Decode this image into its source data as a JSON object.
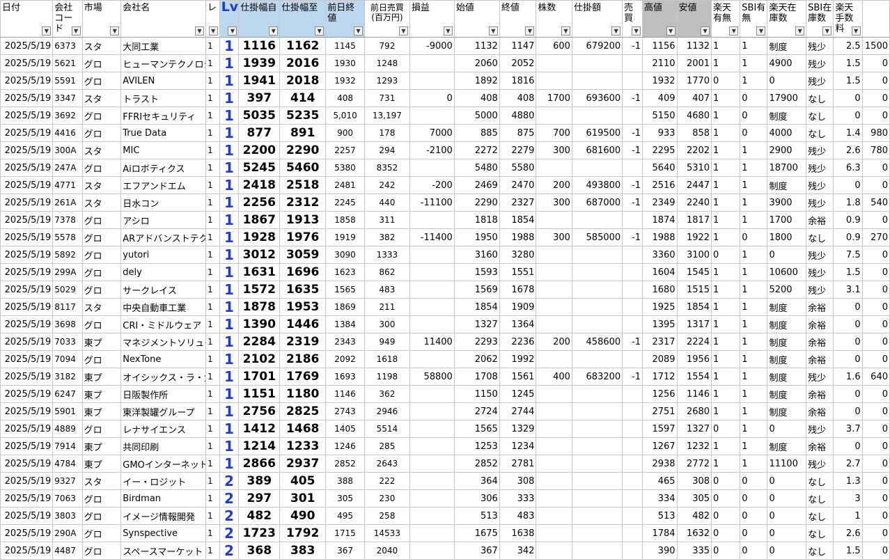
{
  "columns": [
    {
      "key": "date",
      "label": "日付",
      "w": 73
    },
    {
      "key": "code",
      "label": "会社コード",
      "w": 41
    },
    {
      "key": "market",
      "label": "市場",
      "w": 54
    },
    {
      "key": "name",
      "label": "会社名",
      "w": 118
    },
    {
      "key": "rei",
      "label": "レ",
      "w": 19
    },
    {
      "key": "lv",
      "label": "Lv",
      "w": 27
    },
    {
      "key": "from",
      "label": "仕掛幅自",
      "w": 57
    },
    {
      "key": "to",
      "label": "仕掛幅至",
      "w": 64
    },
    {
      "key": "prevclose",
      "label": "前日終値",
      "w": 54
    },
    {
      "key": "prevsell",
      "label": "前日売買(百万円)",
      "w": 63
    },
    {
      "key": "pl",
      "label": "損益",
      "w": 62
    },
    {
      "key": "open",
      "label": "始値",
      "w": 63
    },
    {
      "key": "close",
      "label": "終値",
      "w": 51
    },
    {
      "key": "shares",
      "label": "株数",
      "w": 50
    },
    {
      "key": "amount",
      "label": "仕掛額",
      "w": 70
    },
    {
      "key": "sell",
      "label": "売買",
      "w": 28
    },
    {
      "key": "high",
      "label": "高値",
      "w": 48
    },
    {
      "key": "low",
      "label": "安値",
      "w": 48
    },
    {
      "key": "rak",
      "label": "楽天有無",
      "w": 40
    },
    {
      "key": "sbi",
      "label": "SBI有無",
      "w": 38
    },
    {
      "key": "rakstock",
      "label": "楽天在庫数",
      "w": 54
    },
    {
      "key": "sbistock",
      "label": "SBI在庫数",
      "w": 38
    },
    {
      "key": "fee",
      "label": "楽天手数料",
      "w": 40
    },
    {
      "key": "fee2",
      "label": "",
      "w": 38
    }
  ],
  "rows": [
    [
      "2025/5/19",
      "6373",
      "スタ",
      "大同工業",
      "1",
      "1",
      "1116",
      "1162",
      "1145",
      "792",
      "-9000",
      "1132",
      "1147",
      "600",
      "679200",
      "-1",
      "1156",
      "1132",
      "1",
      "1",
      "制度",
      "残少",
      "2.5",
      "1500"
    ],
    [
      "2025/5/19",
      "5621",
      "グロ",
      "ヒューマンテクノロジーズ",
      "1",
      "1",
      "1939",
      "2016",
      "1930",
      "1248",
      "",
      "2060",
      "2052",
      "",
      "",
      "",
      "2110",
      "2001",
      "1",
      "1",
      "4900",
      "残少",
      "1.5",
      "0"
    ],
    [
      "2025/5/19",
      "5591",
      "グロ",
      "AVILEN",
      "1",
      "1",
      "1941",
      "2018",
      "1932",
      "1293",
      "",
      "1892",
      "1816",
      "",
      "",
      "",
      "1932",
      "1770",
      "0",
      "1",
      "0",
      "残少",
      "1.5",
      "0"
    ],
    [
      "2025/5/19",
      "3347",
      "スタ",
      "トラスト",
      "1",
      "1",
      "397",
      "414",
      "408",
      "731",
      "0",
      "408",
      "408",
      "1700",
      "693600",
      "-1",
      "409",
      "407",
      "1",
      "0",
      "17900",
      "なし",
      "0",
      "0"
    ],
    [
      "2025/5/19",
      "3692",
      "グロ",
      "FFRIセキュリティ",
      "1",
      "1",
      "5035",
      "5235",
      "5,010",
      "13,197",
      "",
      "5000",
      "4880",
      "",
      "",
      "",
      "5150",
      "4680",
      "1",
      "0",
      "制度",
      "なし",
      "0",
      "0"
    ],
    [
      "2025/5/19",
      "4416",
      "グロ",
      "True Data",
      "1",
      "1",
      "877",
      "891",
      "900",
      "178",
      "7000",
      "885",
      "875",
      "700",
      "619500",
      "-1",
      "933",
      "858",
      "1",
      "0",
      "4000",
      "なし",
      "1.4",
      "980"
    ],
    [
      "2025/5/19",
      "300A",
      "スタ",
      "MIC",
      "1",
      "1",
      "2200",
      "2290",
      "2257",
      "294",
      "-2100",
      "2272",
      "2279",
      "300",
      "681600",
      "-1",
      "2295",
      "2202",
      "1",
      "1",
      "2900",
      "残少",
      "2.6",
      "780"
    ],
    [
      "2025/5/19",
      "247A",
      "グロ",
      "Aiロボティクス",
      "1",
      "1",
      "5245",
      "5460",
      "5380",
      "8352",
      "",
      "5480",
      "5580",
      "",
      "",
      "",
      "5640",
      "5310",
      "1",
      "1",
      "18700",
      "残少",
      "6.3",
      "0"
    ],
    [
      "2025/5/19",
      "4771",
      "スタ",
      "エフアンドエム",
      "1",
      "1",
      "2418",
      "2518",
      "2481",
      "242",
      "-200",
      "2469",
      "2470",
      "200",
      "493800",
      "-1",
      "2516",
      "2447",
      "1",
      "1",
      "制度",
      "残少",
      "0",
      "0"
    ],
    [
      "2025/5/19",
      "261A",
      "スタ",
      "日水コン",
      "1",
      "1",
      "2256",
      "2312",
      "2245",
      "440",
      "-11100",
      "2290",
      "2327",
      "300",
      "687000",
      "-1",
      "2349",
      "2240",
      "1",
      "1",
      "3900",
      "残少",
      "1.8",
      "540"
    ],
    [
      "2025/5/19",
      "7378",
      "グロ",
      "アシロ",
      "1",
      "1",
      "1867",
      "1913",
      "1858",
      "311",
      "",
      "1818",
      "1854",
      "",
      "",
      "",
      "1874",
      "1817",
      "1",
      "1",
      "1700",
      "余裕",
      "0.9",
      "0"
    ],
    [
      "2025/5/19",
      "5578",
      "グロ",
      "ARアドバンストテクノロジ",
      "1",
      "1",
      "1928",
      "1976",
      "1919",
      "382",
      "-11400",
      "1950",
      "1988",
      "300",
      "585000",
      "-1",
      "1988",
      "1922",
      "1",
      "0",
      "1800",
      "なし",
      "0.9",
      "270"
    ],
    [
      "2025/5/19",
      "5892",
      "グロ",
      "yutori",
      "1",
      "1",
      "3012",
      "3059",
      "3090",
      "1333",
      "",
      "3160",
      "3280",
      "",
      "",
      "",
      "3360",
      "3100",
      "0",
      "1",
      "0",
      "残少",
      "7.5",
      "0"
    ],
    [
      "2025/5/19",
      "299A",
      "グロ",
      "dely",
      "1",
      "1",
      "1631",
      "1696",
      "1623",
      "862",
      "",
      "1593",
      "1551",
      "",
      "",
      "",
      "1604",
      "1545",
      "1",
      "1",
      "10600",
      "残少",
      "1.5",
      "0"
    ],
    [
      "2025/5/19",
      "5029",
      "グロ",
      "サークレイス",
      "1",
      "1",
      "1572",
      "1635",
      "1565",
      "483",
      "",
      "1569",
      "1678",
      "",
      "",
      "",
      "1680",
      "1515",
      "1",
      "1",
      "5200",
      "残少",
      "3.1",
      "0"
    ],
    [
      "2025/5/19",
      "8117",
      "スタ",
      "中央自動車工業",
      "1",
      "1",
      "1878",
      "1953",
      "1869",
      "211",
      "",
      "1854",
      "1909",
      "",
      "",
      "",
      "1925",
      "1854",
      "1",
      "1",
      "制度",
      "余裕",
      "0",
      "0"
    ],
    [
      "2025/5/19",
      "3698",
      "グロ",
      "CRI・ミドルウェア",
      "1",
      "1",
      "1390",
      "1446",
      "1384",
      "300",
      "",
      "1327",
      "1364",
      "",
      "",
      "",
      "1395",
      "1317",
      "1",
      "1",
      "制度",
      "余裕",
      "0",
      "0"
    ],
    [
      "2025/5/19",
      "7033",
      "東プ",
      "マネジメントソリューションズ",
      "1",
      "1",
      "2284",
      "2319",
      "2343",
      "949",
      "11400",
      "2293",
      "2236",
      "200",
      "458600",
      "-1",
      "2317",
      "2224",
      "1",
      "1",
      "制度",
      "余裕",
      "0",
      "0"
    ],
    [
      "2025/5/19",
      "7094",
      "グロ",
      "NexTone",
      "1",
      "1",
      "2102",
      "2186",
      "2092",
      "1618",
      "",
      "2062",
      "1992",
      "",
      "",
      "",
      "2089",
      "1956",
      "1",
      "1",
      "制度",
      "余裕",
      "0",
      "0"
    ],
    [
      "2025/5/19",
      "3182",
      "東プ",
      "オイシックス・ラ・大地",
      "1",
      "1",
      "1701",
      "1769",
      "1693",
      "1198",
      "58800",
      "1708",
      "1561",
      "400",
      "683200",
      "-1",
      "1712",
      "1554",
      "1",
      "1",
      "制度",
      "残少",
      "1.6",
      "640"
    ],
    [
      "2025/5/19",
      "6247",
      "東プ",
      "日阪製作所",
      "1",
      "1",
      "1151",
      "1180",
      "1146",
      "362",
      "",
      "1150",
      "1245",
      "",
      "",
      "",
      "1256",
      "1146",
      "1",
      "1",
      "制度",
      "余裕",
      "0",
      "0"
    ],
    [
      "2025/5/19",
      "5901",
      "東プ",
      "東洋製罐グループ",
      "1",
      "1",
      "2756",
      "2825",
      "2743",
      "2946",
      "",
      "2724",
      "2744",
      "",
      "",
      "",
      "2751",
      "2680",
      "1",
      "1",
      "制度",
      "余裕",
      "0",
      "0"
    ],
    [
      "2025/5/19",
      "4889",
      "グロ",
      "レナサイエンス",
      "1",
      "1",
      "1412",
      "1468",
      "1405",
      "5514",
      "",
      "1565",
      "1329",
      "",
      "",
      "",
      "1597",
      "1327",
      "0",
      "1",
      "0",
      "残少",
      "3.7",
      "0"
    ],
    [
      "2025/5/19",
      "7914",
      "東プ",
      "共同印刷",
      "1",
      "1",
      "1214",
      "1233",
      "1246",
      "285",
      "",
      "1253",
      "1234",
      "",
      "",
      "",
      "1267",
      "1232",
      "1",
      "1",
      "制度",
      "余裕",
      "0",
      "0"
    ],
    [
      "2025/5/19",
      "4784",
      "東プ",
      "GMOインターネット",
      "1",
      "1",
      "2866",
      "2937",
      "2852",
      "2643",
      "",
      "2852",
      "2781",
      "",
      "",
      "",
      "2938",
      "2772",
      "1",
      "1",
      "11100",
      "残少",
      "2.7",
      "0"
    ],
    [
      "2025/5/19",
      "9327",
      "スタ",
      "イー・ロジット",
      "1",
      "2",
      "389",
      "405",
      "388",
      "222",
      "",
      "364",
      "308",
      "",
      "",
      "",
      "465",
      "308",
      "0",
      "0",
      "0",
      "なし",
      "1.3",
      "0"
    ],
    [
      "2025/5/19",
      "7063",
      "グロ",
      "Birdman",
      "1",
      "2",
      "297",
      "301",
      "305",
      "230",
      "",
      "306",
      "333",
      "",
      "",
      "",
      "334",
      "305",
      "0",
      "0",
      "0",
      "なし",
      "3",
      "0"
    ],
    [
      "2025/5/19",
      "3803",
      "グロ",
      "イメージ情報開発",
      "1",
      "2",
      "482",
      "490",
      "495",
      "258",
      "",
      "513",
      "483",
      "",
      "",
      "",
      "513",
      "482",
      "0",
      "0",
      "0",
      "なし",
      "1",
      "0"
    ],
    [
      "2025/5/19",
      "290A",
      "グロ",
      "Synspective",
      "1",
      "2",
      "1723",
      "1792",
      "1715",
      "14533",
      "",
      "1675",
      "1638",
      "",
      "",
      "",
      "1784",
      "1632",
      "0",
      "0",
      "0",
      "なし",
      "2.6",
      "0"
    ],
    [
      "2025/5/19",
      "4487",
      "グロ",
      "スペースマーケット",
      "1",
      "2",
      "368",
      "383",
      "367",
      "2040",
      "",
      "367",
      "342",
      "",
      "",
      "",
      "390",
      "335",
      "0",
      "0",
      "0",
      "なし",
      "1.5",
      "0"
    ]
  ],
  "filter_icon": "dropdown-arrow-icon",
  "colors": {
    "header_blue": "#bdd7ee",
    "header_gray": "#bfbfbf",
    "lv_blue": "#1f3bd6",
    "grid": "#c7c7c7"
  }
}
